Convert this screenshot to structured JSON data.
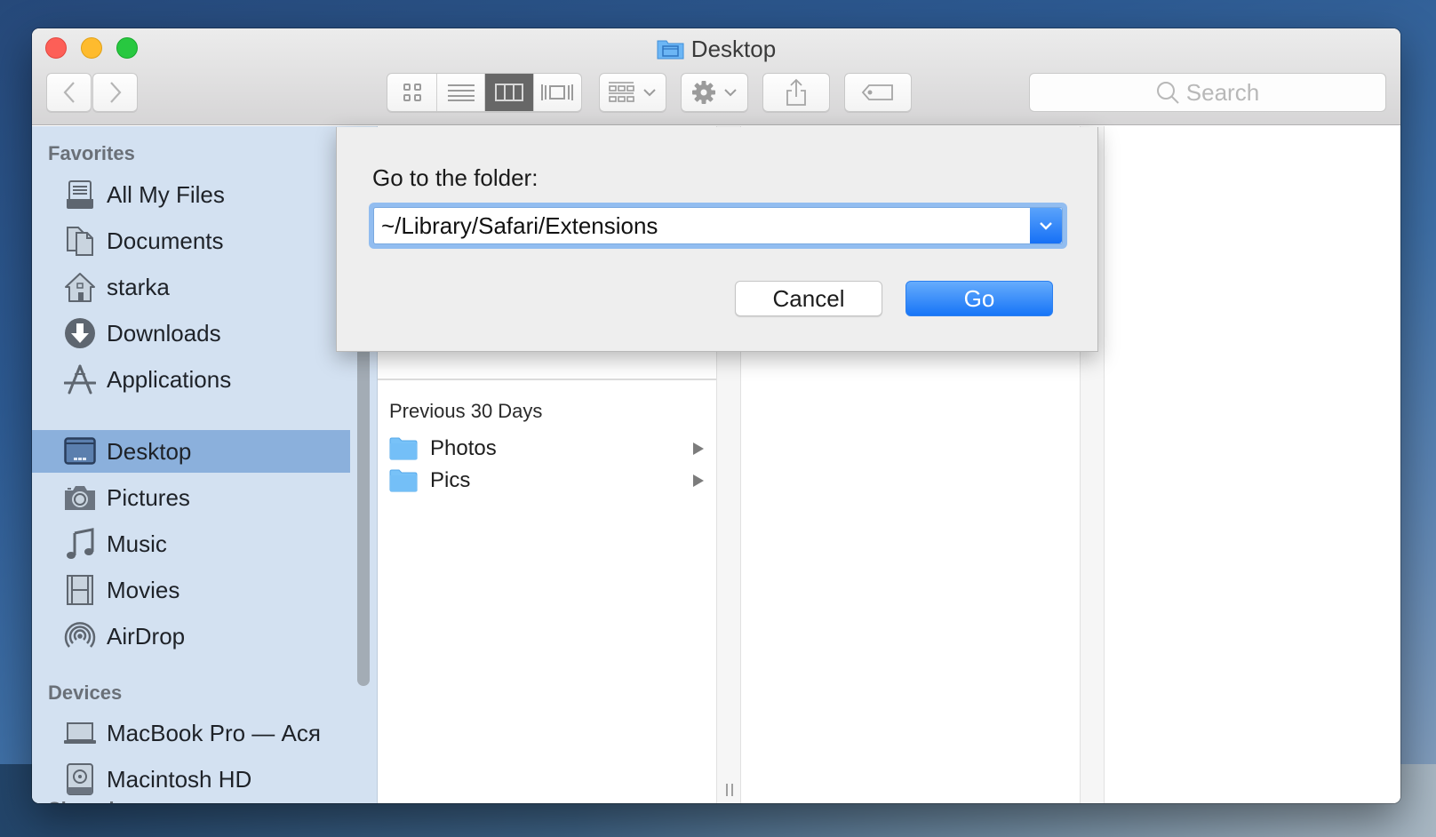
{
  "window": {
    "title": "Desktop",
    "title_icon": "desktop-folder-icon"
  },
  "toolbar": {
    "back": "chevron-left-icon",
    "forward": "chevron-right-icon",
    "view_modes": [
      {
        "name": "icon-view",
        "icon": "grid-icon",
        "active": false
      },
      {
        "name": "list-view",
        "icon": "list-icon",
        "active": false
      },
      {
        "name": "column-view",
        "icon": "columns-icon",
        "active": true
      },
      {
        "name": "cover-flow-view",
        "icon": "cover-flow-icon",
        "active": false
      }
    ],
    "arrange": "arrange-icon",
    "action": "gear-icon",
    "share": "share-icon",
    "tags": "tag-icon",
    "search_placeholder": "Search"
  },
  "sidebar": {
    "favorites_header": "Favorites",
    "favorites": [
      {
        "label": "All My Files",
        "icon": "all-files-icon"
      },
      {
        "label": "Documents",
        "icon": "documents-icon"
      },
      {
        "label": "starka",
        "icon": "home-icon"
      },
      {
        "label": "Downloads",
        "icon": "downloads-icon"
      },
      {
        "label": "Applications",
        "icon": "applications-icon"
      },
      {
        "label": "Desktop",
        "icon": "desktop-icon",
        "selected": true
      },
      {
        "label": "Pictures",
        "icon": "camera-icon"
      },
      {
        "label": "Music",
        "icon": "music-note-icon"
      },
      {
        "label": "Movies",
        "icon": "film-icon"
      },
      {
        "label": "AirDrop",
        "icon": "airdrop-icon"
      }
    ],
    "devices_header": "Devices",
    "devices": [
      {
        "label": "MacBook Pro — Ася",
        "icon": "laptop-icon"
      },
      {
        "label": "Macintosh HD",
        "icon": "hard-drive-icon"
      }
    ],
    "shared_header": "Shared"
  },
  "browser": {
    "group_header": "Previous 30 Days",
    "items": [
      {
        "label": "Photos",
        "icon": "folder-icon",
        "has_children": true
      },
      {
        "label": "Pics",
        "icon": "folder-icon",
        "has_children": true
      }
    ]
  },
  "dialog": {
    "prompt": "Go to the folder:",
    "path_value": "~/Library/Safari/Extensions",
    "cancel_label": "Cancel",
    "go_label": "Go"
  },
  "colors": {
    "accent": "#1775f7",
    "sidebar_bg": "#d3e1f1",
    "sidebar_selected": "#8bb0dc"
  }
}
